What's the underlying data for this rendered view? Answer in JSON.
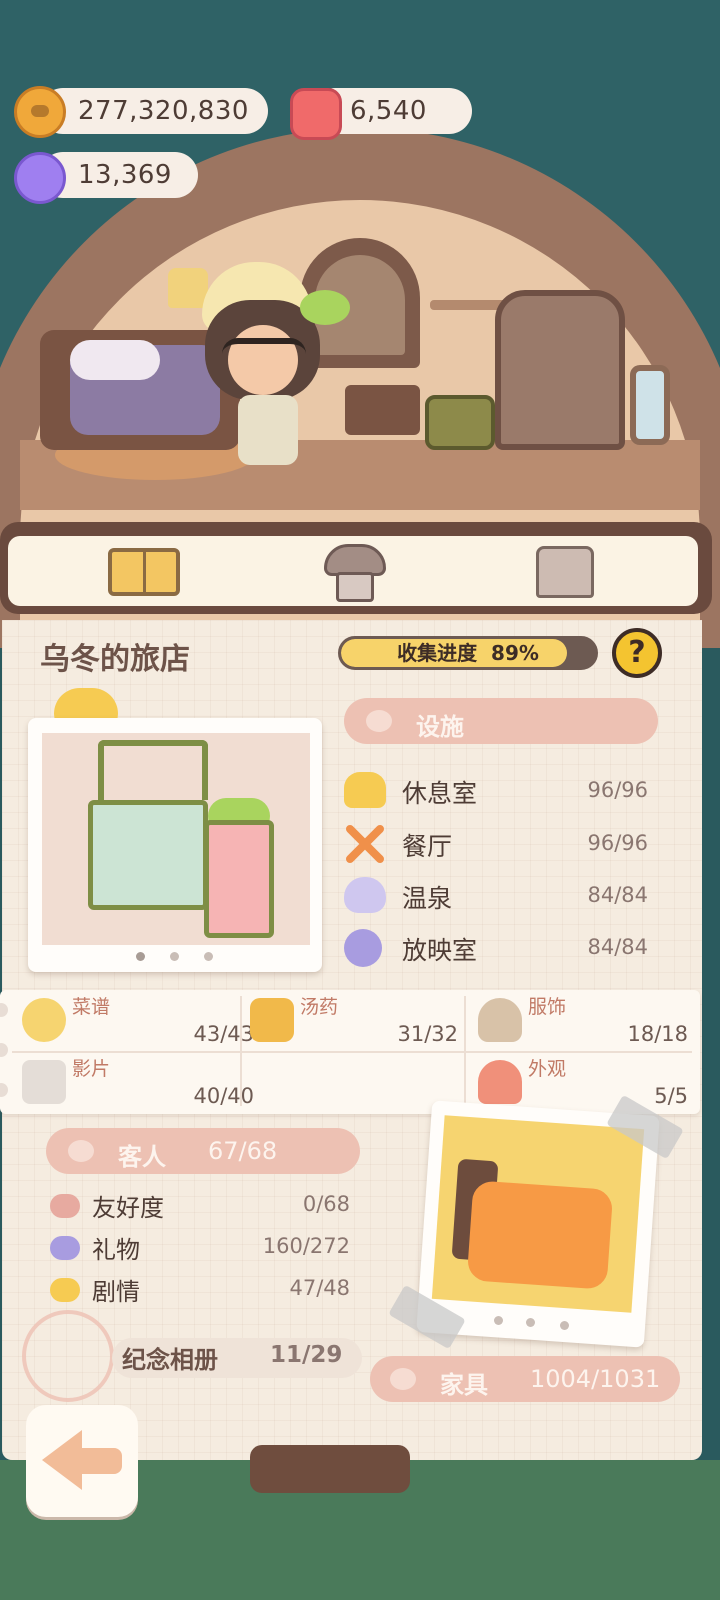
{
  "currency": {
    "coins": "277,320,830",
    "gems": "6,540",
    "candy": "13,369"
  },
  "tabs": [
    {
      "icon": "book-icon"
    },
    {
      "icon": "hotel-icon"
    },
    {
      "icon": "shirt-icon"
    }
  ],
  "hotel": {
    "title": "乌冬的旅店",
    "progress_label": "收集进度",
    "progress_value": "89%",
    "progress_fraction": 0.89,
    "help_label": "?"
  },
  "facilities": {
    "header": "设施",
    "items": [
      {
        "name": "休息室",
        "count": "96/96",
        "icon": "cloud-icon",
        "color": "#f6cb52"
      },
      {
        "name": "餐厅",
        "count": "96/96",
        "icon": "fork-knife-icon",
        "color": "#f0904a"
      },
      {
        "name": "温泉",
        "count": "84/84",
        "icon": "hot-spring-icon",
        "color": "#a89ce0"
      },
      {
        "name": "放映室",
        "count": "84/84",
        "icon": "film-reel-icon",
        "color": "#a89ce0"
      }
    ]
  },
  "categories": [
    {
      "name": "菜谱",
      "count": "43/43",
      "icon": "recipe-icon"
    },
    {
      "name": "汤药",
      "count": "31/32",
      "icon": "potion-icon"
    },
    {
      "name": "服饰",
      "count": "18/18",
      "icon": "outfit-icon"
    },
    {
      "name": "影片",
      "count": "40/40",
      "icon": "clapper-icon"
    },
    {
      "name": "外观",
      "count": "5/5",
      "icon": "house-icon"
    }
  ],
  "guests": {
    "header": "客人",
    "count": "67/68",
    "items": [
      {
        "name": "友好度",
        "count": "0/68",
        "color": "#e7aaa0",
        "icon": "heart-icon"
      },
      {
        "name": "礼物",
        "count": "160/272",
        "color": "#a89ce0",
        "icon": "gift-heart-icon"
      },
      {
        "name": "剧情",
        "count": "47/48",
        "color": "#f6cb52",
        "icon": "story-heart-icon"
      }
    ]
  },
  "album": {
    "label": "纪念相册",
    "count": "11/29"
  },
  "furniture": {
    "label": "家具",
    "count": "1004/1031"
  }
}
